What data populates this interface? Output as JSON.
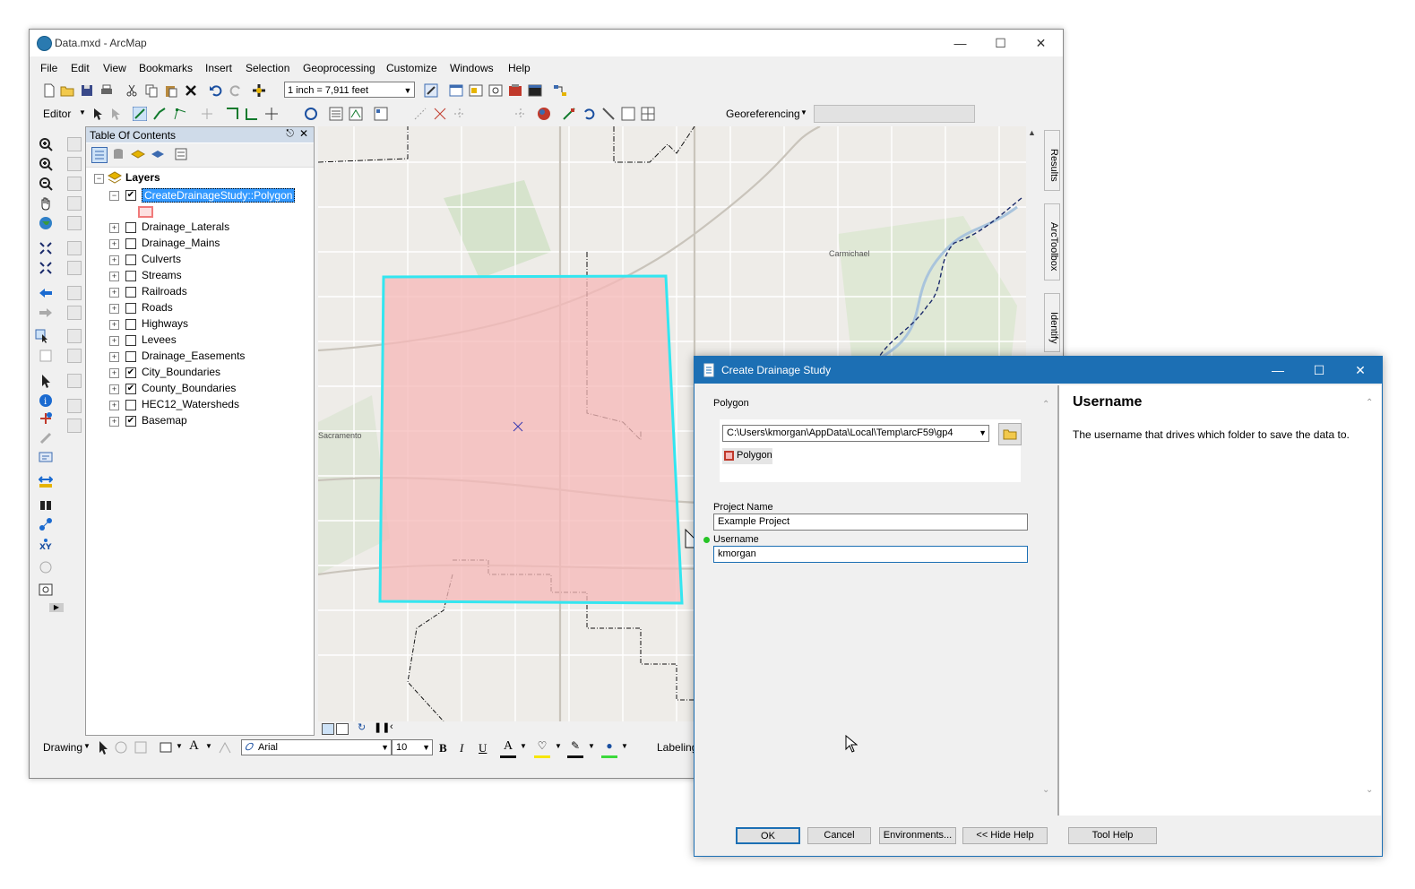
{
  "arcmap": {
    "title": "Data.mxd - ArcMap",
    "menu": [
      "File",
      "Edit",
      "View",
      "Bookmarks",
      "Insert",
      "Selection",
      "Geoprocessing",
      "Customize",
      "Windows",
      "Help"
    ],
    "scale": "1 inch = 7,911 feet",
    "editor_label": "Editor",
    "georeferencing_label": "Georeferencing",
    "toc": {
      "title": "Table Of Contents",
      "root": "Layers",
      "layers": [
        {
          "name": "CreateDrainageStudy::Polygon",
          "checked": true,
          "selected": true
        },
        {
          "name": "Drainage_Laterals",
          "checked": false
        },
        {
          "name": "Drainage_Mains",
          "checked": false
        },
        {
          "name": "Culverts",
          "checked": false
        },
        {
          "name": "Streams",
          "checked": false
        },
        {
          "name": "Railroads",
          "checked": false
        },
        {
          "name": "Roads",
          "checked": false
        },
        {
          "name": "Highways",
          "checked": false
        },
        {
          "name": "Levees",
          "checked": false
        },
        {
          "name": "Drainage_Easements",
          "checked": false
        },
        {
          "name": "City_Boundaries",
          "checked": true
        },
        {
          "name": "County_Boundaries",
          "checked": true
        },
        {
          "name": "HEC12_Watersheds",
          "checked": false
        },
        {
          "name": "Basemap",
          "checked": true
        }
      ]
    },
    "dock_tabs": [
      "Results",
      "ArcToolbox",
      "Identify"
    ],
    "map_labels": {
      "carmichael": "Carmichael",
      "sacramento": "Sacramento"
    },
    "drawing": {
      "label": "Drawing",
      "font": "Arial",
      "size": "10",
      "bold": "B",
      "italic": "I",
      "underline": "U",
      "labeling": "Labeling"
    },
    "colors": {
      "selection_polygon_fill": "#f5b8b8",
      "selection_polygon_outline": "#33e6f0"
    }
  },
  "dialog": {
    "title": "Create Drainage Study",
    "polygon_label": "Polygon",
    "polygon_path": "C:\\Users\\kmorgan\\AppData\\Local\\Temp\\arcF59\\gp4",
    "polygon_item": "Polygon",
    "project_name_label": "Project Name",
    "project_name_value": "Example Project",
    "username_label": "Username",
    "username_value": "kmorgan",
    "help_title": "Username",
    "help_text": "The username that drives which folder to save the data to.",
    "buttons": {
      "ok": "OK",
      "cancel": "Cancel",
      "environments": "Environments...",
      "hide_help": "<< Hide Help",
      "tool_help": "Tool Help"
    },
    "accent": "#1c6fb4"
  }
}
